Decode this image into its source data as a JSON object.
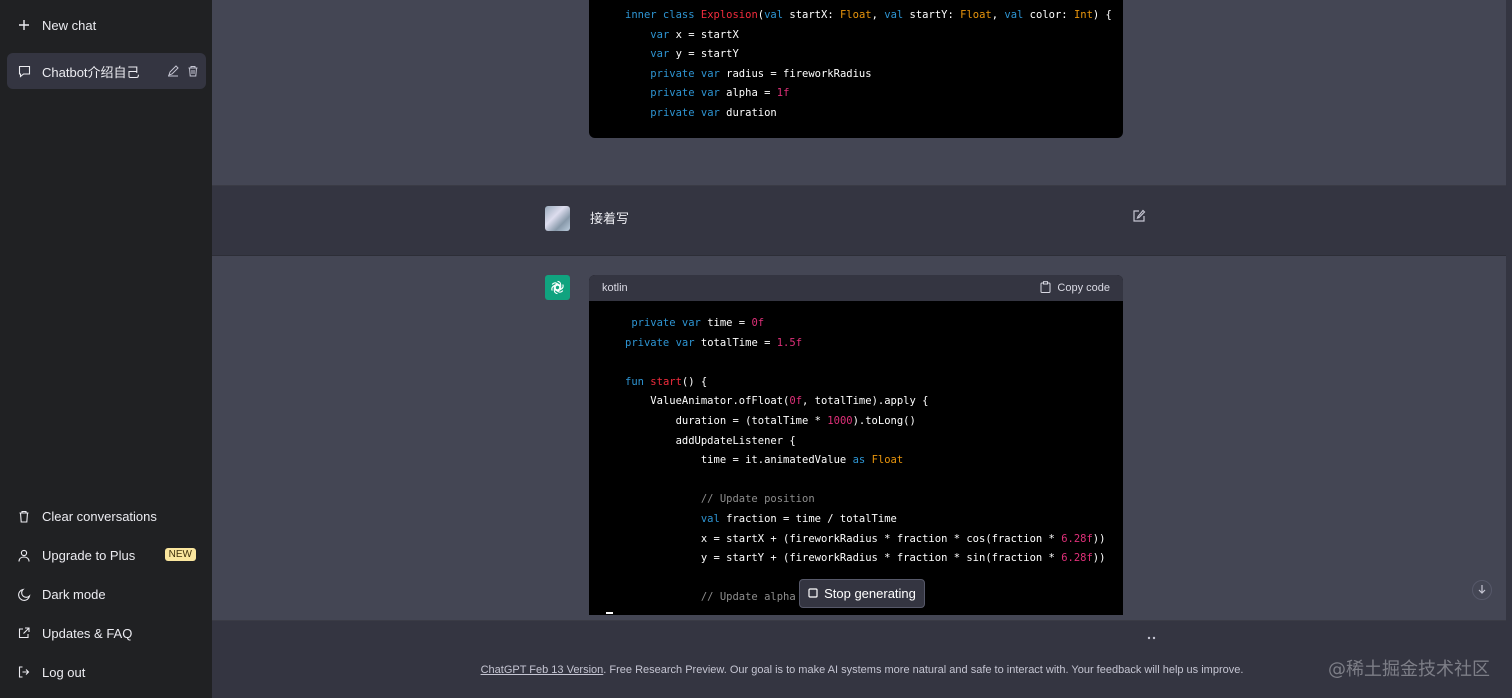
{
  "sidebar": {
    "new_chat": "New chat",
    "conversations": [
      {
        "title": "Chatbot介绍自己",
        "active": true
      }
    ],
    "bottom": {
      "clear": "Clear conversations",
      "upgrade": "Upgrade to Plus",
      "upgrade_badge": "NEW",
      "dark_mode": "Dark mode",
      "updates": "Updates & FAQ",
      "logout": "Log out"
    }
  },
  "messages": {
    "user_prompt": "接着写",
    "code_language": "kotlin",
    "copy_label": "Copy code"
  },
  "controls": {
    "stop_label": "Stop generating"
  },
  "footer": {
    "version_link": "ChatGPT Feb 13 Version",
    "text": ". Free Research Preview. Our goal is to make AI systems more natural and safe to interact with. Your feedback will help us improve."
  },
  "watermark": "@稀土掘金技术社区",
  "colors": {
    "sidebar_bg": "#202123",
    "main_bg": "#343541",
    "ai_row_bg": "#444654",
    "gpt_green": "#10a37f",
    "keyword": "#2e95d3",
    "type": "#e9950c",
    "number": "#df3079"
  }
}
